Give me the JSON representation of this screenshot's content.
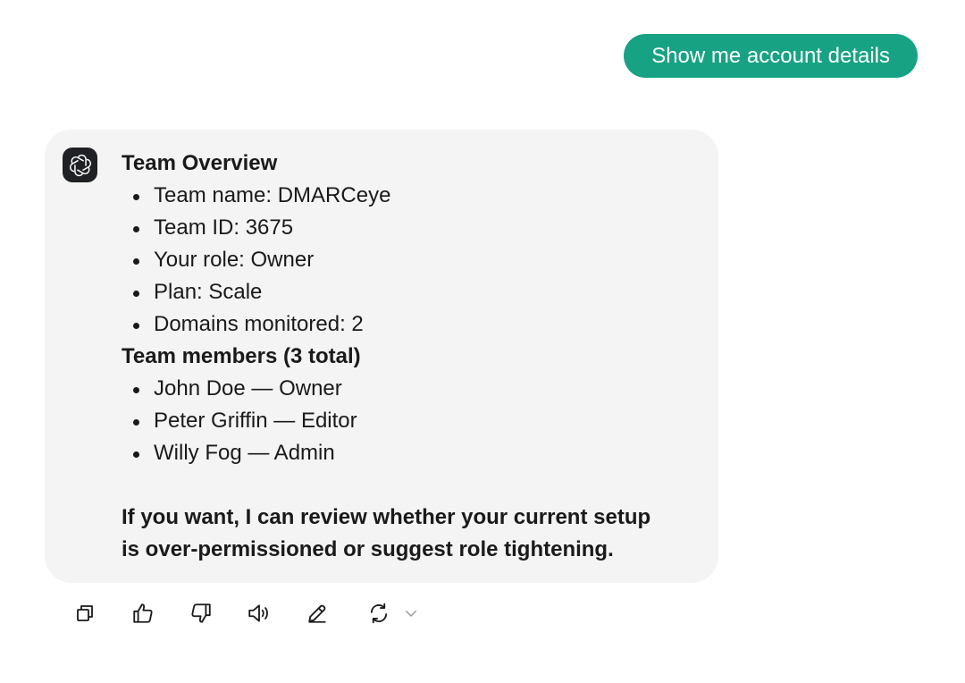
{
  "user_message": "Show me account details",
  "assistant": {
    "avatar_icon": "openai-logo-icon",
    "overview_heading": "Team Overview",
    "overview_items": [
      "Team name: DMARCeye",
      "Team ID: 3675",
      "Your role: Owner",
      "Plan: Scale",
      "Domains monitored: 2"
    ],
    "members_heading": "Team members (3 total)",
    "members": [
      "John Doe — Owner",
      "Peter Griffin — Editor",
      "Willy Fog — Admin"
    ],
    "closing_line_1": "If you want, I can review whether your current setup",
    "closing_line_2": "is over-permissioned or suggest role tightening."
  },
  "actions": [
    "copy-icon",
    "thumbs-up-icon",
    "thumbs-down-icon",
    "speaker-icon",
    "edit-icon",
    "regenerate-icon",
    "chevron-down-icon"
  ],
  "colors": {
    "user_bubble": "#17a383",
    "assistant_bg": "#f4f4f4",
    "avatar_bg": "#202124"
  }
}
